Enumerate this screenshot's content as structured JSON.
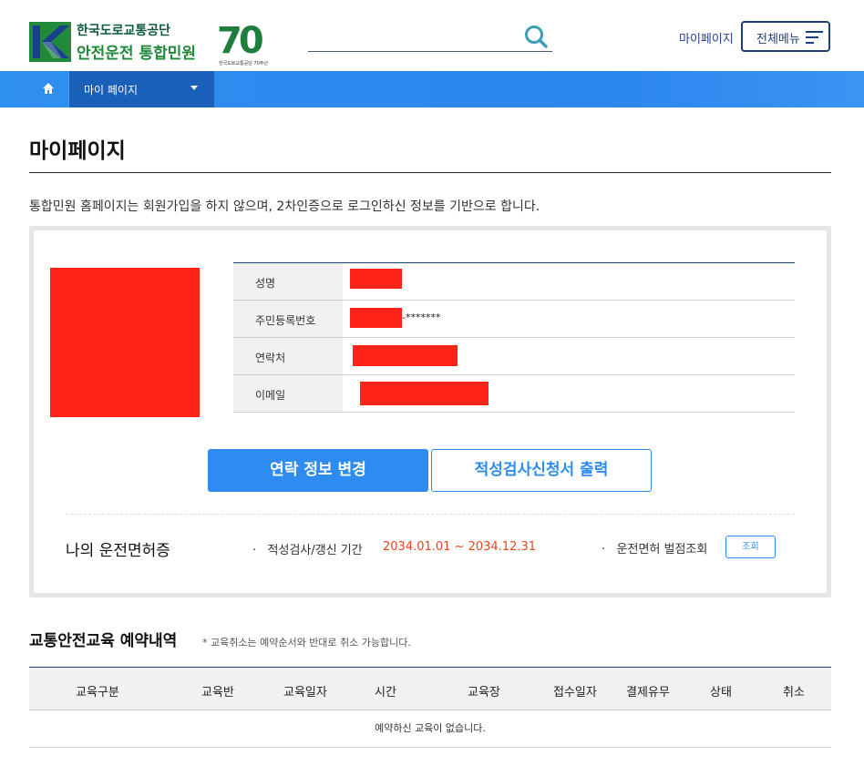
{
  "header": {
    "logo_line1": "한국도로교통공단",
    "logo_line2": "안전운전 통합민원",
    "logo_70": "70",
    "logo_70_sub": "한국도로교통공단 70주년",
    "search": {
      "value": "",
      "placeholder": ""
    },
    "mypage_link": "마이페이지",
    "all_menu_label": "전체메뉴"
  },
  "nav": {
    "dropdown_label": "마이 페이지"
  },
  "page": {
    "title": "마이페이지",
    "intro": "통합민원 홈페이지는 회원가입을 하지 않으며, 2차인증으로 로그인하신 정보를 기반으로 합니다."
  },
  "profile": {
    "rows": [
      {
        "label": "성명",
        "value_tail": ""
      },
      {
        "label": "주민등록번호",
        "value_tail": "-*******"
      },
      {
        "label": "연락처",
        "value_tail": ""
      },
      {
        "label": "이메일",
        "value_tail": ""
      }
    ],
    "change_button": "연락 정보 변경",
    "print_button": "적성검사신청서 출력"
  },
  "license": {
    "title": "나의 운전면허증",
    "period_label": "적성검사/갱신 기간",
    "period_value": "2034.01.01 ~ 2034.12.31",
    "penalty_label": "운전면허 벌점조회",
    "inquiry_button": "조회"
  },
  "reservation": {
    "title": "교통안전교육 예약내역",
    "note": "* 교육취소는 예약순서와 반대로 취소 가능합니다.",
    "columns": [
      "교육구분",
      "교육반",
      "교육일자",
      "시간",
      "교육장",
      "접수일자",
      "결제유무",
      "상태",
      "취소"
    ],
    "empty_message": "예약하신 교육이 없습니다."
  },
  "colors": {
    "brand_blue": "#2e8cf0",
    "navy": "#1d3f7a",
    "redaction": "#ff2219",
    "period_orange": "#e8451f",
    "logo_green": "#1e8a3a"
  }
}
